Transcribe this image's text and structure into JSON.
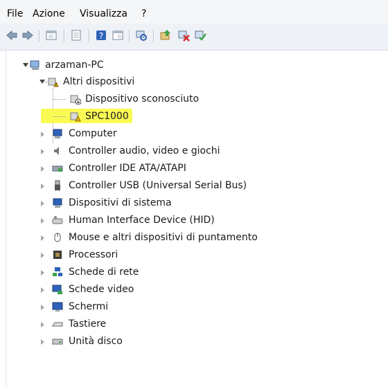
{
  "menu": {
    "file": "File",
    "azione": "Azione",
    "visualizza": "Visualizza",
    "help": "?"
  },
  "tree": {
    "root": "arzaman-PC",
    "altri": "Altri dispositivi",
    "sconosciuto": "Dispositivo sconosciuto",
    "spc": "SPC1000",
    "categories": [
      "Computer",
      "Controller audio, video e giochi",
      "Controller IDE ATA/ATAPI",
      "Controller USB (Universal Serial Bus)",
      "Dispositivi di sistema",
      "Human Interface Device (HID)",
      "Mouse e altri dispositivi di puntamento",
      "Processori",
      "Schede di rete",
      "Schede video",
      "Schermi",
      "Tastiere",
      "Unità disco"
    ]
  },
  "colors": {
    "highlight": "#fafa55",
    "toolbar": "#eef1f5",
    "warning": "#e6b800"
  }
}
